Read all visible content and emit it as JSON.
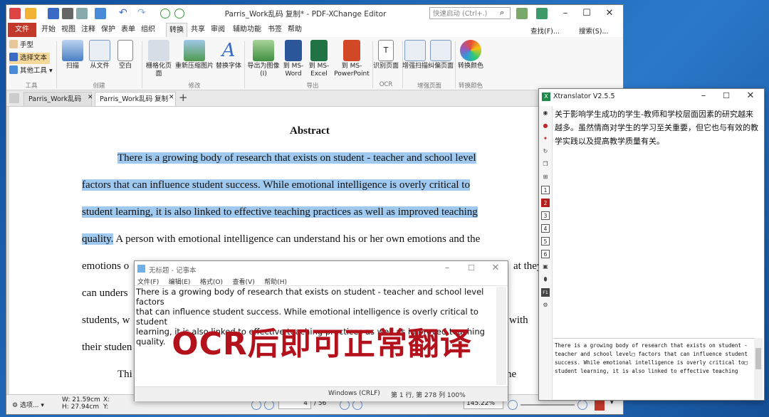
{
  "pdf_editor": {
    "title": "Parris_Work乱码 复制* - PDF-XChange Editor",
    "quick_search_placeholder": "快速启动 (Ctrl+.)",
    "find_label": "查找(F)...",
    "search_label": "搜索(S)...",
    "menu": [
      "文件",
      "开始",
      "视图",
      "注释",
      "保护",
      "表单",
      "组织",
      "转换",
      "共享",
      "审阅",
      "辅助功能",
      "书签",
      "帮助"
    ],
    "tools": {
      "hand": "手型",
      "select_text": "选择文本",
      "other_tools": "其他工具",
      "group": "工具"
    },
    "ribbon_buttons": [
      {
        "label": "扫描",
        "group": "创建"
      },
      {
        "label": "从文件",
        "group": "创建"
      },
      {
        "label": "空白",
        "group": "创建"
      },
      {
        "label": "栅格化页面",
        "group": "修改"
      },
      {
        "label": "重新压缩图片",
        "group": "修改"
      },
      {
        "label": "替换字体",
        "group": "修改"
      },
      {
        "label": "导出为图像(I)",
        "group": "导出"
      },
      {
        "label": "到 MS-\nWord",
        "group": "导出"
      },
      {
        "label": "到 MS-\nExcel",
        "group": "导出"
      },
      {
        "label": "到 MS-\nPowerPoint",
        "group": "导出"
      },
      {
        "label": "识别页面",
        "group": "OCR"
      },
      {
        "label": "增强扫描",
        "group": "增强页面"
      },
      {
        "label": "纠偏页面",
        "group": "增强页面"
      },
      {
        "label": "转换颜色",
        "group": "转换颜色"
      }
    ],
    "groups": [
      "工具",
      "创建",
      "修改",
      "导出",
      "OCR",
      "增强页面",
      "转换颜色"
    ],
    "doc_tabs": [
      "Parris_Work乱码",
      "Parris_Work乱码 复制 *"
    ],
    "page": {
      "heading": "Abstract",
      "lines": [
        "There is a growing body of research that exists on student -  teacher and school level",
        "factors that can influence student success. While emotional intelligence is overly critical to",
        "student learning, it is also linked to effective teaching practices as well as improved teaching",
        "quality.",
        " A person with emotional intelligence can understand his or her own emotions and the",
        "emotions o",
        "at they",
        "can unders",
        "students, w",
        "with",
        "their studen",
        "Thi",
        "he"
      ]
    },
    "status": {
      "options": "选项...",
      "width": "W: 21.59cm",
      "height": "H: 27.94cm",
      "x": "X:",
      "y": "Y:",
      "page_num": "4",
      "page_total": "/ 56",
      "zoom": "145.22%"
    }
  },
  "notepad": {
    "title": "无标题 - 记事本",
    "menu": [
      "文件(F)",
      "编辑(E)",
      "格式(O)",
      "查看(V)",
      "帮助(H)"
    ],
    "text_lines": [
      "There is a growing body of research that exists on student - teacher and school level factors",
      "that can influence student success. While emotional intelligence is overly critical to student",
      "learning, it is also linked to effective teaching practices as well as improved teaching quality."
    ],
    "overlay": "OCR后即可正常翻译",
    "status_encoding": "Windows (CRLF)",
    "status_pos": "第 1 行, 第 278 列  100%"
  },
  "xtranslator": {
    "title": "Xtranslator V2.5.5",
    "translation": "关于影响学生成功的学生-教师和学校层面因素的研究越来越多。虽然情商对学生的学习至关重要，但它也与有效的教学实践以及提高教学质量有关。",
    "source_lines": [
      "There is a growing body of research that exists on student -",
      "teacher and school level□ factors that can influence student",
      "success. While emotional intelligence is overly critical to□",
      "student learning, it is also linked to effective teaching"
    ],
    "side_numbers": [
      "1",
      "2",
      "3",
      "4",
      "5",
      "6"
    ]
  },
  "colors": {
    "accent_red": "#c0392b",
    "highlight": "#9fc9ef",
    "overlay_text": "#b3121d"
  }
}
